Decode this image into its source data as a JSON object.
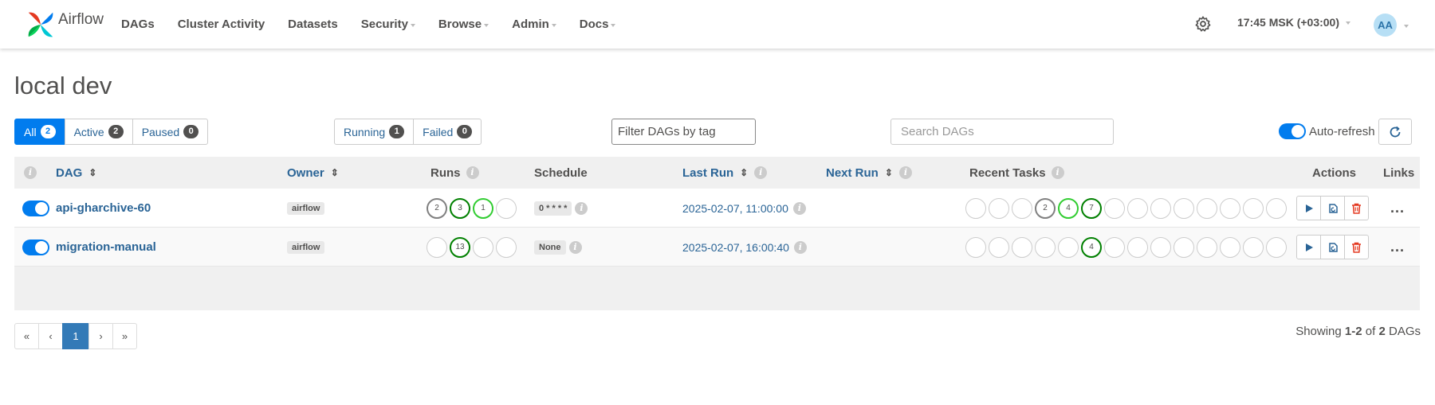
{
  "navbar": {
    "brand": "Airflow",
    "items": [
      {
        "label": "DAGs",
        "dropdown": false
      },
      {
        "label": "Cluster Activity",
        "dropdown": false
      },
      {
        "label": "Datasets",
        "dropdown": false
      },
      {
        "label": "Security",
        "dropdown": true
      },
      {
        "label": "Browse",
        "dropdown": true
      },
      {
        "label": "Admin",
        "dropdown": true
      },
      {
        "label": "Docs",
        "dropdown": true
      }
    ],
    "time": "17:45 MSK (+03:00)",
    "avatar": "AA"
  },
  "page_title": "local dev",
  "status_filters": [
    {
      "label": "All",
      "count": "2",
      "active": true
    },
    {
      "label": "Active",
      "count": "2",
      "active": false
    },
    {
      "label": "Paused",
      "count": "0",
      "active": false
    }
  ],
  "run_filters": [
    {
      "label": "Running",
      "count": "1"
    },
    {
      "label": "Failed",
      "count": "0"
    }
  ],
  "tag_filter": {
    "value": "Filter DAGs by tag"
  },
  "search": {
    "placeholder": "Search DAGs"
  },
  "auto_refresh": {
    "label": "Auto-refresh",
    "on": true
  },
  "table": {
    "headers": {
      "dag": "DAG",
      "owner": "Owner",
      "runs": "Runs",
      "schedule": "Schedule",
      "last_run": "Last Run",
      "next_run": "Next Run",
      "recent_tasks": "Recent Tasks",
      "actions": "Actions",
      "links": "Links"
    },
    "rows": [
      {
        "name": "api-gharchive-60",
        "owner": "airflow",
        "runs": [
          {
            "count": "2",
            "state": "gray"
          },
          {
            "count": "3",
            "state": "green"
          },
          {
            "count": "1",
            "state": "lime"
          },
          {
            "count": "",
            "state": "none"
          }
        ],
        "schedule": "0 * * * *",
        "last_run": "2025-02-07, 11:00:00",
        "next_run": "",
        "recent_tasks": [
          {
            "count": "",
            "state": "none"
          },
          {
            "count": "",
            "state": "none"
          },
          {
            "count": "",
            "state": "none"
          },
          {
            "count": "2",
            "state": "gray"
          },
          {
            "count": "4",
            "state": "lime"
          },
          {
            "count": "7",
            "state": "green"
          },
          {
            "count": "",
            "state": "none"
          },
          {
            "count": "",
            "state": "none"
          },
          {
            "count": "",
            "state": "none"
          },
          {
            "count": "",
            "state": "none"
          },
          {
            "count": "",
            "state": "none"
          },
          {
            "count": "",
            "state": "none"
          },
          {
            "count": "",
            "state": "none"
          },
          {
            "count": "",
            "state": "none"
          }
        ],
        "links": "..."
      },
      {
        "name": "migration-manual",
        "owner": "airflow",
        "runs": [
          {
            "count": "",
            "state": "none"
          },
          {
            "count": "13",
            "state": "green"
          },
          {
            "count": "",
            "state": "none"
          },
          {
            "count": "",
            "state": "none"
          }
        ],
        "schedule": "None",
        "last_run": "2025-02-07, 16:00:40",
        "next_run": "",
        "recent_tasks": [
          {
            "count": "",
            "state": "none"
          },
          {
            "count": "",
            "state": "none"
          },
          {
            "count": "",
            "state": "none"
          },
          {
            "count": "",
            "state": "none"
          },
          {
            "count": "",
            "state": "none"
          },
          {
            "count": "4",
            "state": "green"
          },
          {
            "count": "",
            "state": "none"
          },
          {
            "count": "",
            "state": "none"
          },
          {
            "count": "",
            "state": "none"
          },
          {
            "count": "",
            "state": "none"
          },
          {
            "count": "",
            "state": "none"
          },
          {
            "count": "",
            "state": "none"
          },
          {
            "count": "",
            "state": "none"
          },
          {
            "count": "",
            "state": "none"
          }
        ],
        "links": "..."
      }
    ]
  },
  "pagination": {
    "first": "«",
    "prev": "‹",
    "current": "1",
    "next": "›",
    "last": "»"
  },
  "showing": {
    "prefix": "Showing ",
    "range": "1-2",
    "middle": " of ",
    "total": "2",
    "suffix": " DAGs"
  },
  "colors": {
    "accent": "#017cee",
    "link": "#2a6496",
    "success": "#008000",
    "running": "#32cd32",
    "queued": "#808080",
    "delete": "#e43921"
  },
  "icons": {
    "settings": "gear-icon",
    "refresh": "refresh-icon",
    "trigger": "play-icon",
    "reparse": "reparse-icon",
    "delete": "trash-icon",
    "info": "info-icon",
    "sort": "sort-icon"
  }
}
